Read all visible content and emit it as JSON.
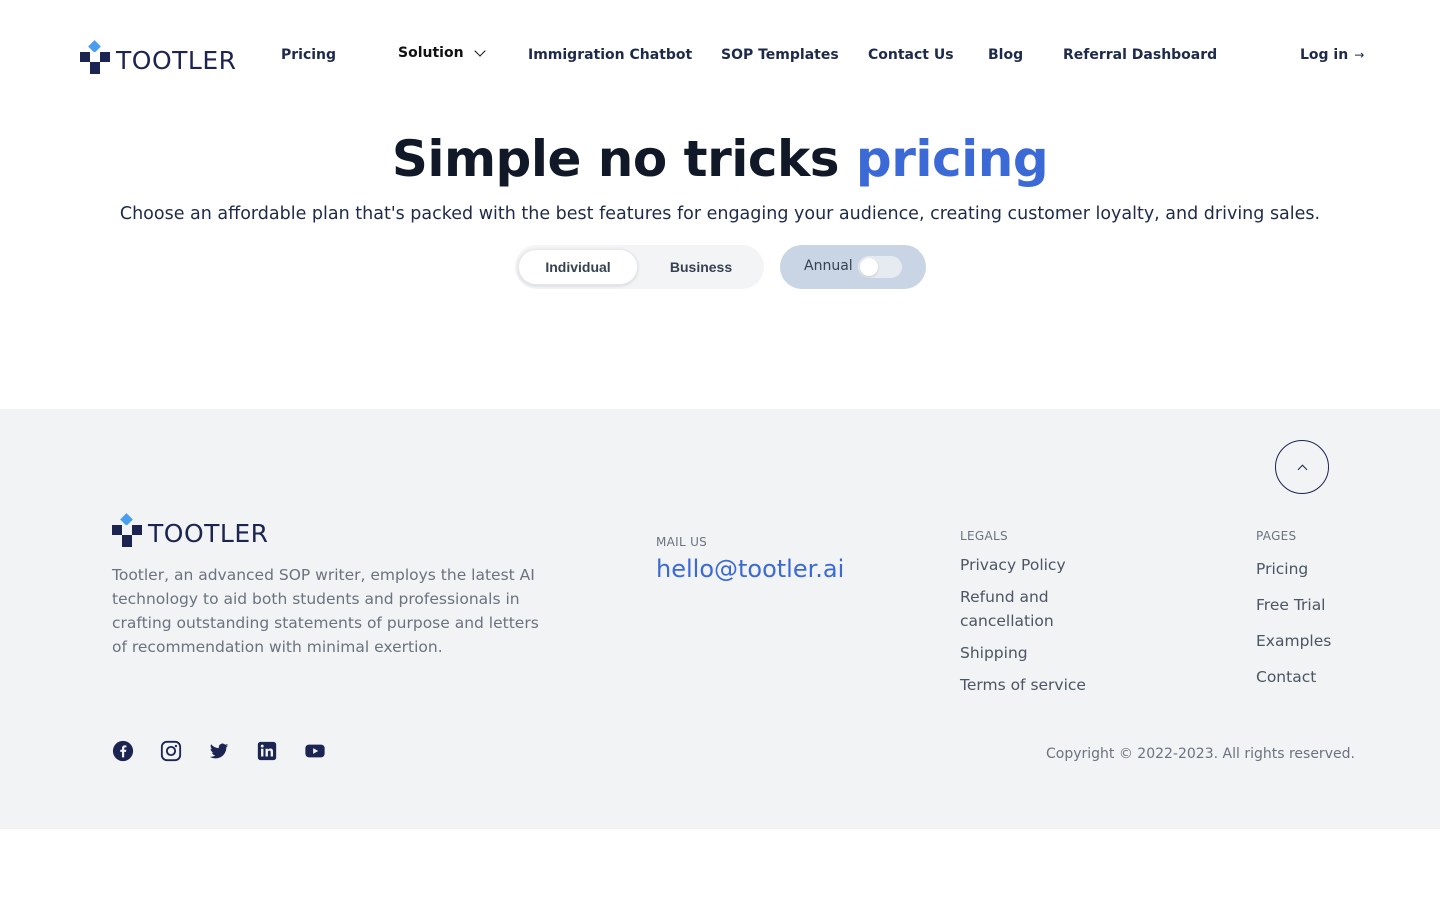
{
  "brand": {
    "name": "TOOTLER"
  },
  "nav": {
    "pricing": "Pricing",
    "solution": "Solution",
    "chatbot": "Immigration Chatbot",
    "sop_templates": "SOP Templates",
    "contact": "Contact Us",
    "blog": "Blog",
    "referral": "Referral Dashboard",
    "login": "Log in",
    "login_arrow": "→"
  },
  "hero": {
    "title_main": "Simple no tricks ",
    "title_accent": "pricing",
    "subtitle": "Choose an affordable plan that's packed with the best features for engaging your audience, creating customer loyalty, and driving sales."
  },
  "plan_toggle": {
    "individual": "Individual",
    "business": "Business",
    "selected": "Individual"
  },
  "billing": {
    "label": "Annual",
    "enabled": false
  },
  "footer": {
    "about": "Tootler, an advanced SOP writer, employs the latest AI technology to aid both students and professionals in crafting outstanding statements of purpose and letters of recommendation with minimal exertion.",
    "mail_heading": "MAIL US",
    "email": "hello@tootler.ai",
    "legals_heading": "LEGALS",
    "legals": [
      "Privacy Policy",
      "Refund and cancellation",
      "Shipping",
      "Terms of service"
    ],
    "pages_heading": "PAGES",
    "pages": [
      "Pricing",
      "Free Trial",
      "Examples",
      "Contact"
    ],
    "copyright": "Copyright © 2022-2023. All rights reserved.",
    "socials": [
      "facebook-icon",
      "instagram-icon",
      "twitter-icon",
      "linkedin-icon",
      "youtube-icon"
    ]
  },
  "colors": {
    "brand_navy": "#1c2451",
    "brand_light_blue": "#4a9ef0",
    "accent_blue": "#3b6ad6",
    "footer_bg": "#f2f3f5",
    "annual_bg": "#c9d4e4"
  }
}
